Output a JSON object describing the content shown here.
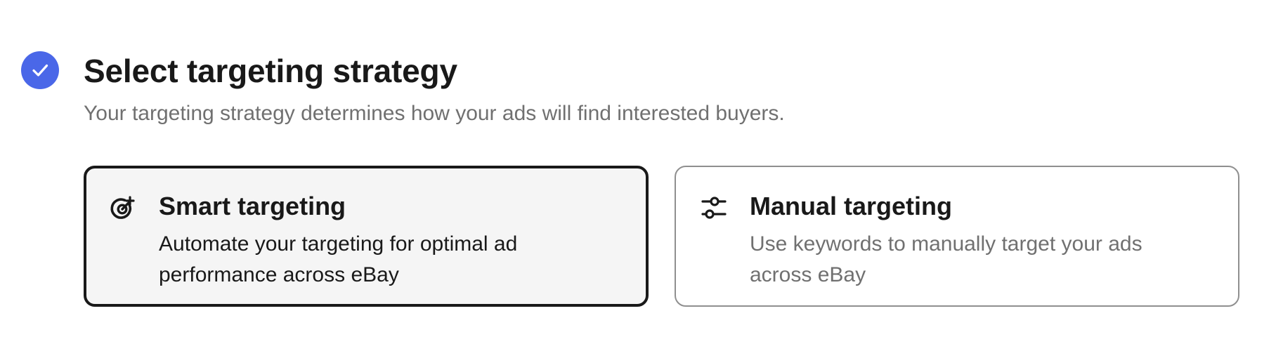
{
  "section": {
    "title": "Select targeting strategy",
    "subtitle": "Your targeting strategy determines how your ads will find interested buyers.",
    "step_icon": "check-circle-icon",
    "accent_color": "#4a67e8"
  },
  "options": [
    {
      "title": "Smart targeting",
      "description": "Automate your targeting for optimal ad performance across eBay",
      "icon": "target-sparkle-icon",
      "selected": true
    },
    {
      "title": "Manual targeting",
      "description": "Use keywords to manually target your ads across eBay",
      "icon": "sliders-icon",
      "selected": false
    }
  ]
}
